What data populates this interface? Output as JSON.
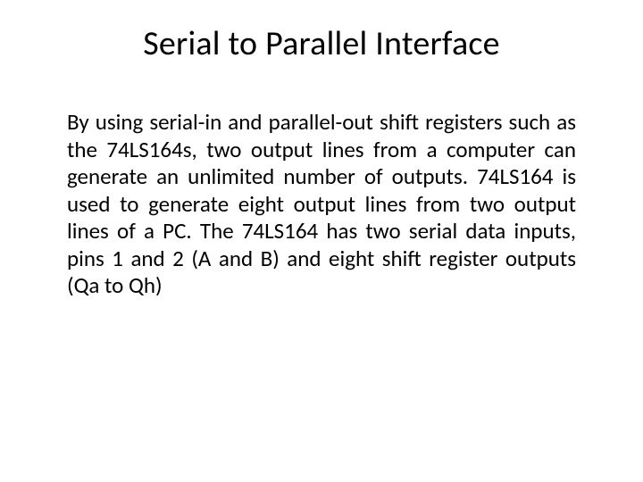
{
  "slide": {
    "title": "Serial to Parallel Interface",
    "body": "By using serial-in and parallel-out shift registers such as the 74LS164s, two output lines from a computer can generate an unlimited number of outputs.  74LS164 is used to generate eight output lines from two output lines of a PC. The 74LS164 has two serial data inputs, pins 1 and 2 (A and B) and eight shift register outputs (Qa to Qh)"
  }
}
